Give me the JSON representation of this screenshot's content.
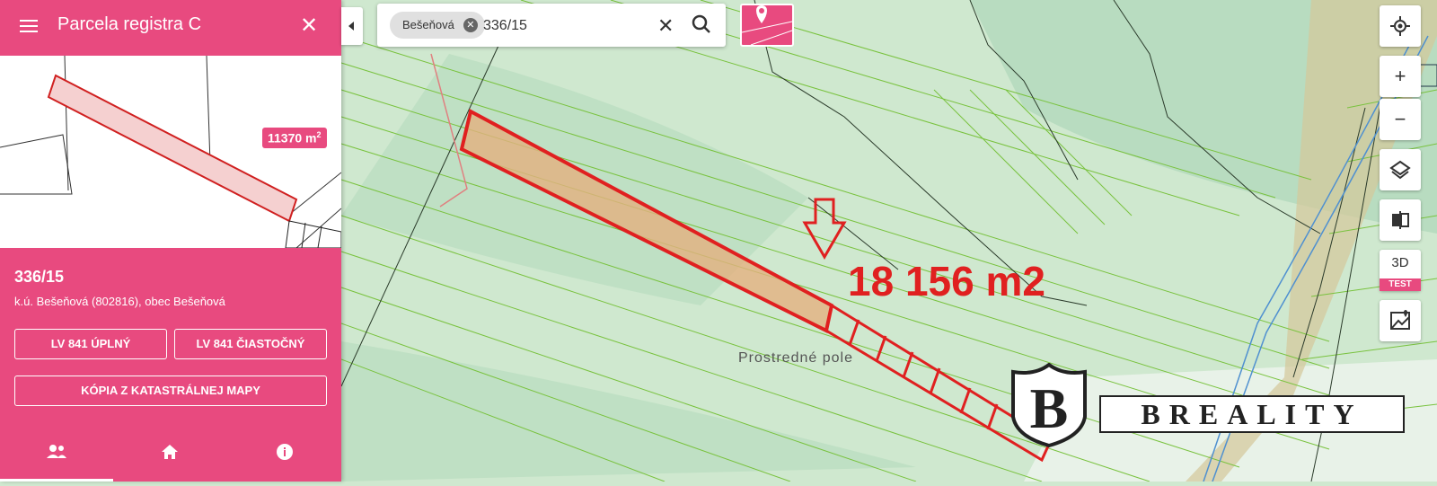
{
  "panel": {
    "title": "Parcela registra C",
    "area_badge": "11370 m",
    "area_badge_sup": "2",
    "parcel_id": "336/15",
    "location": "k.ú. Bešeňová (802816), obec Bešeňová",
    "buttons": {
      "lv_full": "LV 841 ÚPLNÝ",
      "lv_partial": "LV 841 ČIASTOČNÝ",
      "map_copy": "KÓPIA Z KATASTRÁLNEJ MAPY"
    },
    "tabs": [
      {
        "icon": "people-icon"
      },
      {
        "icon": "home-icon"
      },
      {
        "icon": "info-icon"
      }
    ]
  },
  "search": {
    "chip": "Bešeňová",
    "value": "336/15"
  },
  "map": {
    "annotation": "18 156 m2",
    "place_name": "Prostredné pole",
    "logo_letter": "B",
    "logo_text": "BREALITY"
  },
  "controls": {
    "three_d": "3D",
    "test_badge": "TEST",
    "icons": [
      "locate-icon",
      "zoom-in-icon",
      "zoom-out-icon",
      "layers-icon",
      "compare-icon",
      "three-d-icon",
      "street-view-icon"
    ]
  },
  "colors": {
    "accent": "#e84a7f",
    "parcel_outline": "#e02020",
    "map_base": "#cfe8cf"
  }
}
